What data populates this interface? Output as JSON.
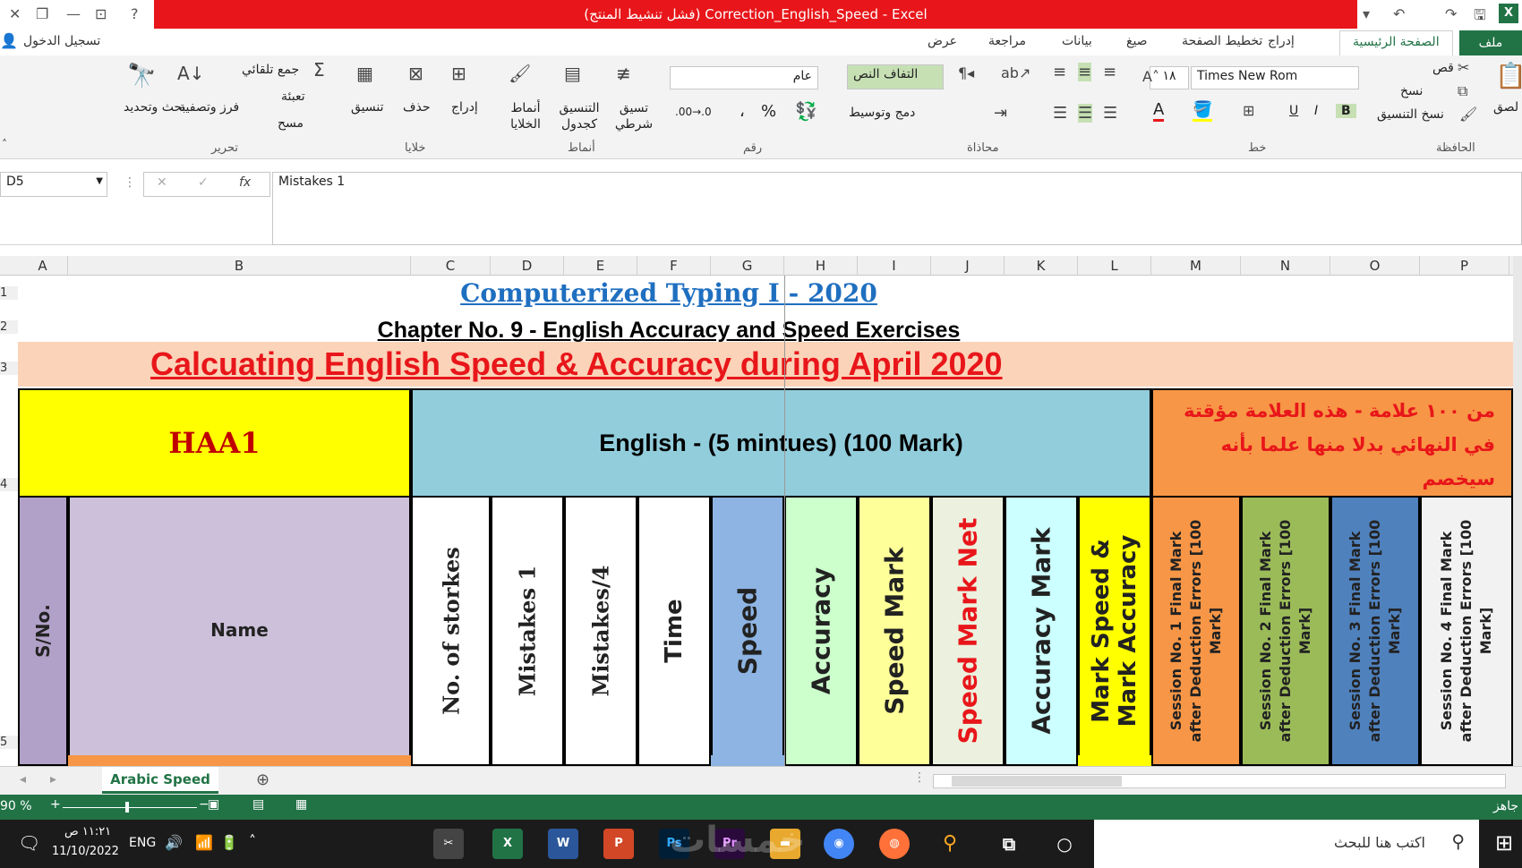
{
  "window": {
    "title": "Correction_English_Speed  -  Excel",
    "activation": "(فشل تنشيط المنتج)"
  },
  "ribbon_tabs": [
    "ملف",
    "الصفحة الرئيسية",
    "إدراج",
    "تخطيط الصفحة",
    "صيغ",
    "بيانات",
    "مراجعة",
    "عرض"
  ],
  "signin": "تسجيل الدخول",
  "ribbon": {
    "clipboard": {
      "label": "الحافظة",
      "paste": "لصق",
      "cut": "قص",
      "copy": "نسخ",
      "format_painter": "نسخ التنسيق"
    },
    "font": {
      "label": "خط",
      "name": "Times New Rom",
      "size": "١٨",
      "bold": "B",
      "italic": "I",
      "underline": "U"
    },
    "alignment": {
      "label": "محاذاة",
      "wrap": "التفاف النص",
      "merge": "دمج وتوسيط"
    },
    "number": {
      "label": "رقم",
      "format": "عام",
      "percent": "%",
      "comma": "،"
    },
    "styles": {
      "label": "أنماط",
      "conditional": "تسيق شرطي",
      "table": "التنسيق كجدول",
      "cell": "أنماط الخلايا"
    },
    "cells": {
      "label": "خلايا",
      "insert": "إدراج",
      "delete": "حذف",
      "format": "تنسيق"
    },
    "editing": {
      "label": "تحرير",
      "autosum": "جمع تلقائي",
      "fill": "تعبئة",
      "clear": "مسح",
      "sort": "فرز وتصفية",
      "find": "بحث وتحديد"
    }
  },
  "formula_bar": {
    "name_box": "D5",
    "fx": "fx",
    "content": "Mistakes 1"
  },
  "columns": [
    "A",
    "B",
    "C",
    "D",
    "E",
    "F",
    "G",
    "H",
    "I",
    "J",
    "K",
    "L",
    "M",
    "N",
    "O",
    "P"
  ],
  "rows": [
    "1",
    "2",
    "3",
    "4",
    "5"
  ],
  "sheet": {
    "title": "Computerized Typing I - 2020",
    "subtitle": "Chapter No. 9 - English Accuracy and Speed Exercises",
    "banner": "Calcuating English Speed & Accuracy  during April 2020",
    "class": "HAA1",
    "english": "English -  (5 mintues) (100 Mark)",
    "arabic_note": "من ١٠٠ علامة  - هذه العلامة مؤقتة\nفي النهائي بدلا منها  علما بأنه سيخصم\nفي العمود التالى",
    "headers": [
      "S/No.",
      "Name",
      "No. of storkes",
      "Mistakes 1",
      "Mistakes/4",
      "Time",
      "Speed",
      "Accuracy",
      "Speed Mark",
      "Speed Mark Net",
      "Accuracy Mark",
      "Mark Speed & Mark Accuracy",
      "Session No. 1 Final Mark after Deduction Errors    [100 Mark]",
      "Session No. 2 Final Mark after Deduction Errors    [100 Mark]",
      "Session No. 3 Final Mark after Deduction Errors    [100 Mark]",
      "Session No. 4 Final Mark after Deduction Errors    [100 Mark]"
    ]
  },
  "sheet_tab": "Arabic Speed",
  "status": {
    "zoom": "90 %",
    "ready": "جاهز"
  },
  "taskbar": {
    "time": "١١:٢١ ص",
    "date": "11/10/2022",
    "lang": "ENG",
    "search": "اكتب هنا للبحث",
    "watermark": "خمسات"
  },
  "colors": {
    "excel_green": "#217346",
    "title_red": "#e8161a"
  }
}
